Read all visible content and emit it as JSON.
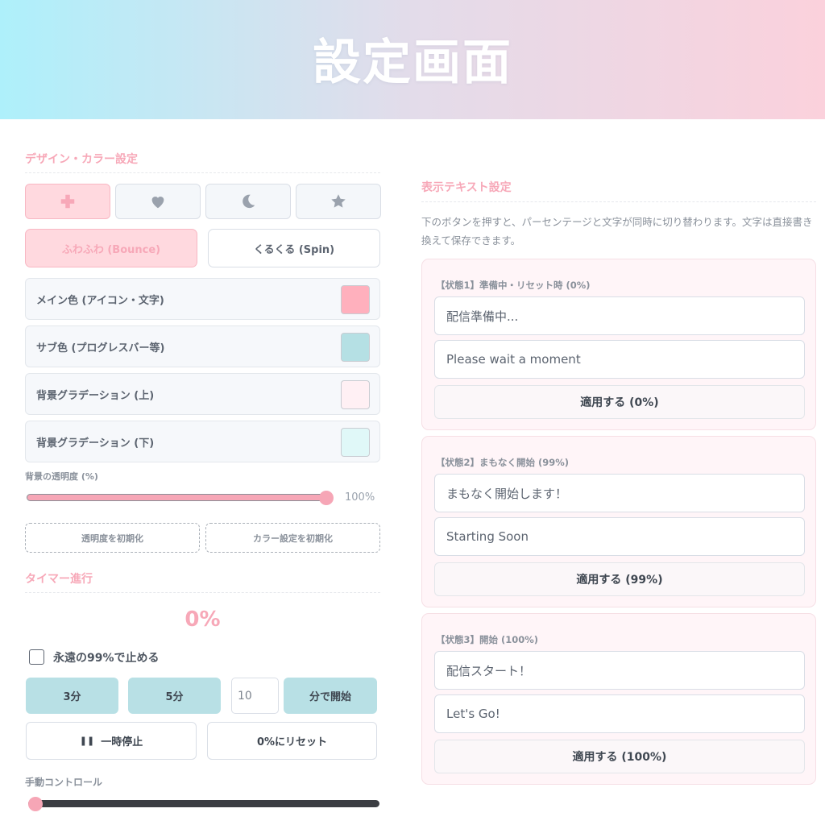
{
  "header": {
    "title": "設定画面"
  },
  "design": {
    "section_title": "デザイン・カラー設定",
    "icons": [
      "plus-icon",
      "heart-icon",
      "moon-icon",
      "star-icon"
    ],
    "animation": {
      "bounce_label": "ふわふわ (Bounce)",
      "spin_label": "くるくる (Spin)"
    },
    "colors": [
      {
        "label": "メイン色 (アイコン・文字)",
        "value": "#ffb0bd"
      },
      {
        "label": "サブ色 (プログレスバー等)",
        "value": "#b5e0e4"
      },
      {
        "label": "背景グラデーション (上)",
        "value": "#fff0f4"
      },
      {
        "label": "背景グラデーション (下)",
        "value": "#e0f8f8"
      }
    ],
    "opacity": {
      "label": "背景の透明度 (%)",
      "value_text": "100%",
      "value": 100
    },
    "reset_opacity_label": "透明度を初期化",
    "reset_color_label": "カラー設定を初期化"
  },
  "timer": {
    "section_title": "タイマー進行",
    "percent_text": "0%",
    "stop99_label": "永遠の99%で止める",
    "btn_3min": "3分",
    "btn_5min": "5分",
    "minutes_value": "10",
    "start_label": "分で開始",
    "pause_label": "一時停止",
    "reset_label": "0%にリセット",
    "manual_label": "手動コントロール",
    "manual_value": 0
  },
  "text_settings": {
    "section_title": "表示テキスト設定",
    "description": "下のボタンを押すと、パーセンテージと文字が同時に切り替わります。文字は直接書き換えて保存できます。",
    "states": [
      {
        "title": "【状態1】準備中・リセット時 (0%)",
        "line1": "配信準備中...",
        "line2": "Please wait a moment",
        "apply": "適用する (0%)"
      },
      {
        "title": "【状態2】まもなく開始 (99%)",
        "line1": "まもなく開始します！",
        "line2": "Starting Soon",
        "apply": "適用する (99%)"
      },
      {
        "title": "【状態3】開始 (100%)",
        "line1": "配信スタート！",
        "line2": "Let's Go!",
        "apply": "適用する (100%)"
      }
    ]
  },
  "colors": {
    "accent": "#f7a8b8",
    "sub": "#b8e0e5",
    "text": "#5c6470"
  }
}
